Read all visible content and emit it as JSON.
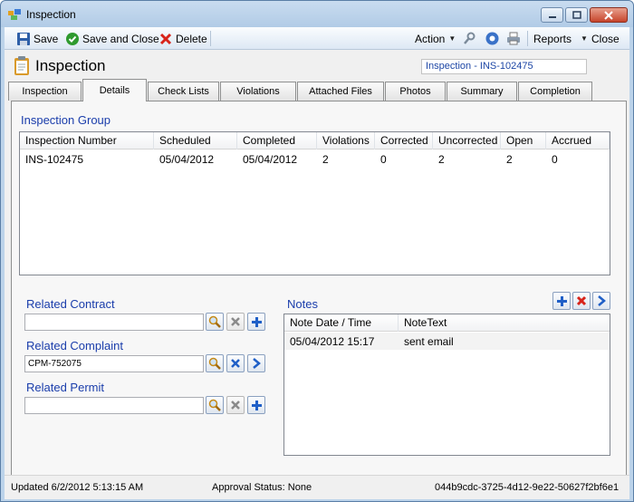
{
  "window": {
    "title": "Inspection"
  },
  "toolbar": {
    "save": "Save",
    "save_close": "Save and Close",
    "delete": "Delete",
    "action": "Action",
    "reports": "Reports",
    "close": "Close"
  },
  "header": {
    "title": "Inspection",
    "badge": "Inspection - INS-102475"
  },
  "tabs": [
    "Inspection",
    "Details",
    "Check Lists",
    "Violations",
    "Attached Files",
    "Photos",
    "Summary",
    "Completion"
  ],
  "active_tab": "Details",
  "inspection_group": {
    "label": "Inspection Group",
    "columns": [
      "Inspection Number",
      "Scheduled",
      "Completed",
      "Violations",
      "Corrected",
      "Uncorrected",
      "Open",
      "Accrued"
    ],
    "rows": [
      [
        "INS-102475",
        "05/04/2012",
        "05/04/2012",
        "2",
        "0",
        "2",
        "2",
        "0"
      ]
    ]
  },
  "related": {
    "contract": {
      "label": "Related Contract",
      "value": ""
    },
    "complaint": {
      "label": "Related Complaint",
      "value": "CPM-752075"
    },
    "permit": {
      "label": "Related Permit",
      "value": ""
    }
  },
  "notes": {
    "label": "Notes",
    "columns": [
      "Note Date / Time",
      "NoteText"
    ],
    "rows": [
      [
        "05/04/2012 15:17",
        "sent email"
      ]
    ]
  },
  "status": {
    "updated": "Updated 6/2/2012 5:13:15 AM",
    "approval": "Approval Status: None",
    "guid": "044b9cdc-3725-4d12-9e22-50627f2bf6e1"
  },
  "colors": {
    "accent_label": "#1a3dab",
    "window_frame": "#bcd3ea"
  }
}
